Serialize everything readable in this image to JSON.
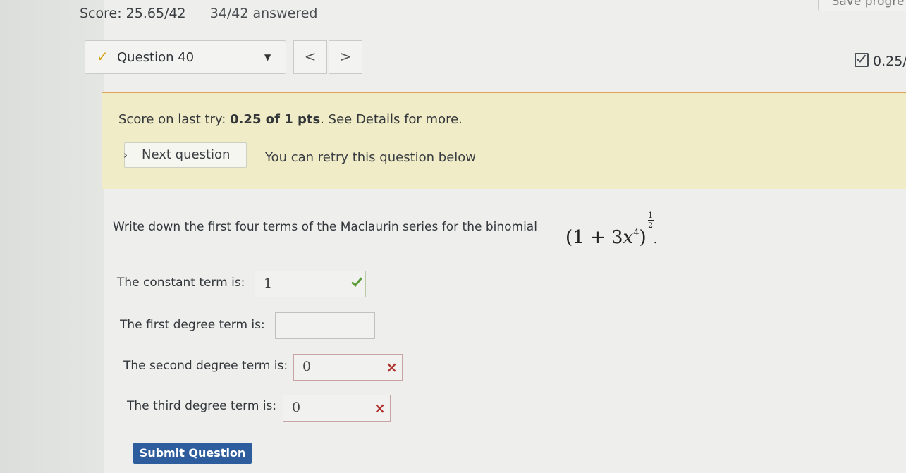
{
  "header": {
    "score": "Score: 25.65/42",
    "answered": "34/42 answered",
    "save_label": "Save progre"
  },
  "question_nav": {
    "selected_question": "Question 40",
    "prev_label": "<",
    "next_label": ">",
    "question_score": "0.25/"
  },
  "banner": {
    "score_prefix": "Score on last try: ",
    "score_value": "0.25 of 1 pts",
    "score_suffix": ". See Details for more.",
    "next_question_label": "Next question",
    "retry_text": "You can retry this question below"
  },
  "question": {
    "prompt": "Write down the first four terms of the Maclaurin series for the binomial",
    "expression": {
      "base_open": "(1 + 3",
      "variable": "x",
      "power": "4",
      "base_close": ")",
      "exp_num": "1",
      "exp_den": "2",
      "end": "."
    },
    "fields": [
      {
        "label": "The constant term is:",
        "value": "1",
        "status": "correct"
      },
      {
        "label": "The first degree term is:",
        "value": "",
        "status": "empty"
      },
      {
        "label": "The second degree term is:",
        "value": "0",
        "status": "wrong"
      },
      {
        "label": "The third degree term is:",
        "value": "0",
        "status": "wrong"
      }
    ]
  },
  "submit_label": "Submit Question",
  "colors": {
    "banner_bg": "#efecc7",
    "accent_orange": "#e0a458",
    "submit_blue": "#2d5d9c",
    "correct_green": "#5a9a35",
    "wrong_red": "#b0322f"
  }
}
